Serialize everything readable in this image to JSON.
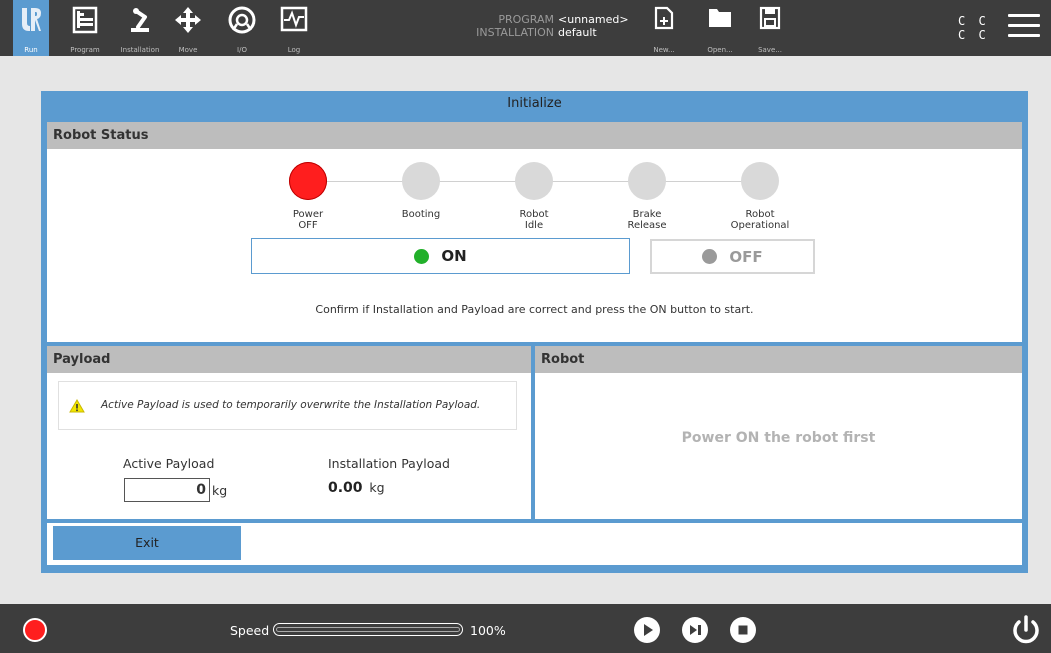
{
  "topbar": {
    "tabs": [
      {
        "label": "Run",
        "icon": "ur-logo-icon"
      },
      {
        "label": "Program",
        "icon": "program-icon"
      },
      {
        "label": "Installation",
        "icon": "robot-arm-icon"
      },
      {
        "label": "Move",
        "icon": "move-arrows-icon"
      },
      {
        "label": "I/O",
        "icon": "io-icon"
      },
      {
        "label": "Log",
        "icon": "log-icon"
      }
    ],
    "program_key": "PROGRAM",
    "program_value": "<unnamed>",
    "installation_key": "INSTALLATION",
    "installation_value": "default",
    "file_buttons": [
      {
        "label": "New...",
        "icon": "new-file-icon"
      },
      {
        "label": "Open...",
        "icon": "folder-icon"
      },
      {
        "label": "Save...",
        "icon": "save-icon"
      }
    ],
    "cc_line1": "C C",
    "cc_line2": "C C",
    "active_tab_color": "#5b9bd0"
  },
  "dialog": {
    "title": "Initialize",
    "robot_status": {
      "header": "Robot Status",
      "steps": [
        {
          "line1": "Power",
          "line2": "OFF",
          "active": true
        },
        {
          "line1": "Booting",
          "line2": "",
          "active": false
        },
        {
          "line1": "Robot",
          "line2": "Idle",
          "active": false
        },
        {
          "line1": "Brake",
          "line2": "Release",
          "active": false
        },
        {
          "line1": "Robot",
          "line2": "Operational",
          "active": false
        }
      ],
      "on_label": "ON",
      "off_label": "OFF",
      "confirm_text": "Confirm if Installation and Payload are correct and press the ON button to start."
    },
    "payload": {
      "header": "Payload",
      "warning": "Active Payload is used to temporarily overwrite the Installation Payload.",
      "active_label": "Active Payload",
      "active_value": "0",
      "active_unit": "kg",
      "installation_label": "Installation Payload",
      "installation_value": "0.00",
      "installation_unit": "kg"
    },
    "robot": {
      "header": "Robot",
      "message": "Power ON the robot first"
    },
    "exit_label": "Exit"
  },
  "bottombar": {
    "speed_label": "Speed",
    "speed_value": "100%",
    "speed_fraction": 1.0
  },
  "colors": {
    "accent": "#5b9bd0",
    "power_off": "#ff1e1e",
    "led_on": "#22b02a",
    "led_off": "#9a9a9a"
  }
}
